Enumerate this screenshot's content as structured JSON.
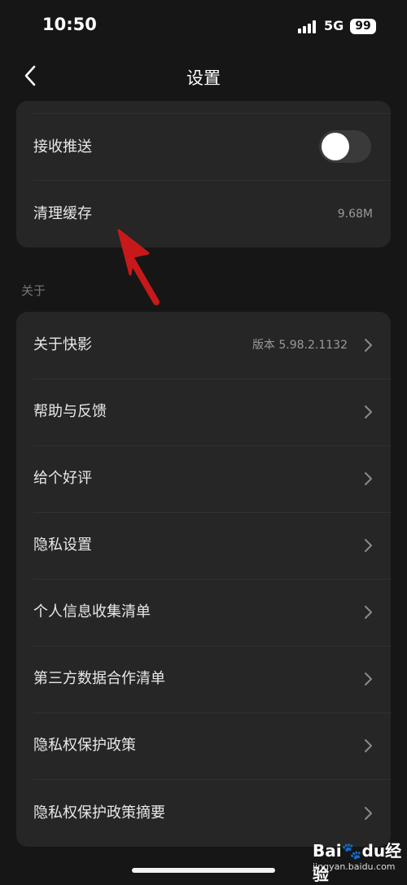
{
  "status_bar": {
    "time": "10:50",
    "network": "5G",
    "battery": "99"
  },
  "nav": {
    "title": "设置",
    "back_icon": "chevron-left-icon"
  },
  "settings_group": {
    "push_label": "接收推送",
    "push_enabled": false,
    "cache_label": "清理缓存",
    "cache_size": "9.68M"
  },
  "about_section": {
    "header": "关于",
    "items": [
      {
        "label": "关于快影",
        "value": "版本 5.98.2.1132"
      },
      {
        "label": "帮助与反馈",
        "value": ""
      },
      {
        "label": "给个好评",
        "value": ""
      },
      {
        "label": "隐私设置",
        "value": ""
      },
      {
        "label": "个人信息收集清单",
        "value": ""
      },
      {
        "label": "第三方数据合作清单",
        "value": ""
      },
      {
        "label": "隐私权保护政策",
        "value": ""
      },
      {
        "label": "隐私权保护政策摘要",
        "value": ""
      }
    ]
  },
  "colors": {
    "background": "#161616",
    "card": "#262626",
    "annotation_arrow": "#c8191a"
  },
  "watermark": {
    "logo_text_1": "Bai",
    "logo_text_2": "du",
    "logo_text_3": "经验",
    "url": "jingyan.baidu.com"
  }
}
